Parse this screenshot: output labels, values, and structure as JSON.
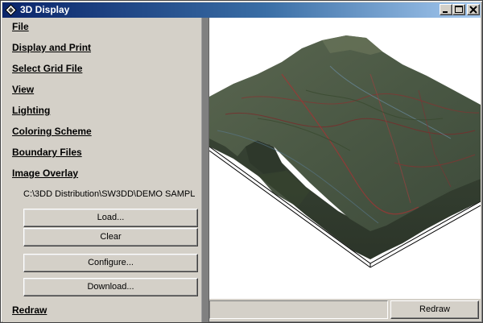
{
  "window": {
    "title": "3D Display"
  },
  "panel": {
    "sections": [
      {
        "label": "File"
      },
      {
        "label": "Display and Print"
      },
      {
        "label": "Select Grid File"
      },
      {
        "label": "View"
      },
      {
        "label": "Lighting"
      },
      {
        "label": "Coloring Scheme"
      },
      {
        "label": "Boundary Files"
      },
      {
        "label": "Image Overlay"
      }
    ],
    "image_overlay_path": "C:\\3DD Distribution\\SW3DD\\DEMO SAMPL",
    "buttons": {
      "load": "Load...",
      "clear": "Clear",
      "configure": "Configure...",
      "download": "Download..."
    },
    "redraw_link": "Redraw"
  },
  "footer": {
    "redraw_button": "Redraw",
    "status_text": ""
  },
  "colors": {
    "titlebar_start": "#0a246a",
    "titlebar_end": "#a6caf0",
    "face": "#d4d0c8",
    "terrain_base": "#4b5a45"
  },
  "icons": {
    "title": "app-diamond-icon",
    "minimize": "minimize-icon",
    "maximize": "maximize-icon",
    "close": "close-icon"
  }
}
